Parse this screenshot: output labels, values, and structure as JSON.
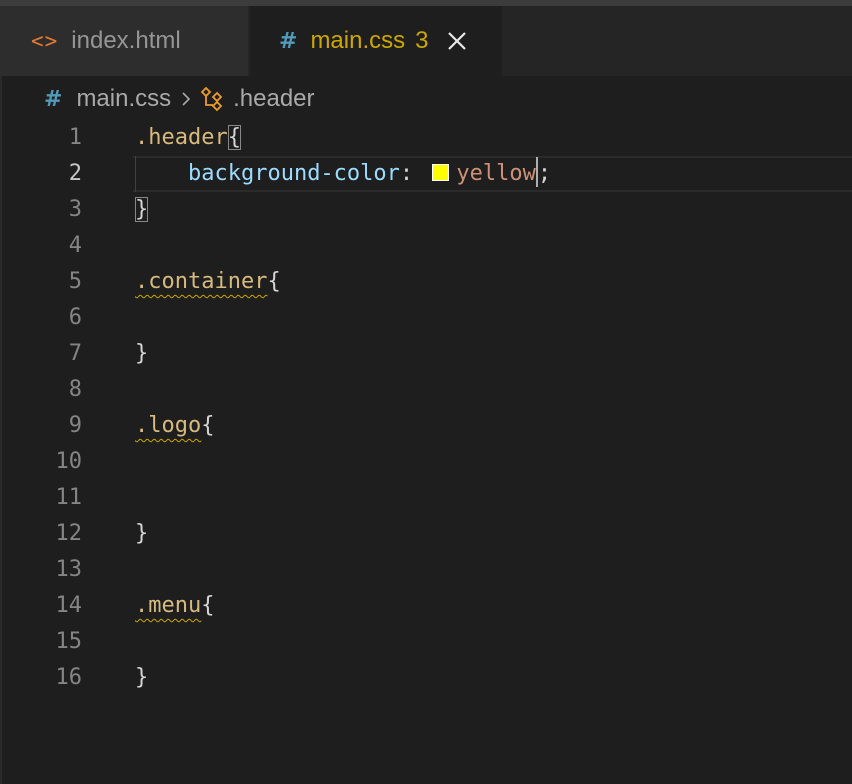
{
  "tabs": [
    {
      "icon": "html-file-icon",
      "glyph": "<>",
      "label": "index.html"
    },
    {
      "icon": "css-file-icon",
      "glyph": "#",
      "label": "main.css",
      "problems": "3",
      "active": true
    }
  ],
  "breadcrumb": {
    "file_glyph": "#",
    "file": "main.css",
    "symbol": ".header"
  },
  "colors": {
    "selector": "#d7ba7d",
    "property": "#9cdcfe",
    "value": "#ce9178",
    "warning": "#cca700",
    "swatch": "#ffff00"
  },
  "editor": {
    "current_line": 2,
    "line_numbers": [
      "1",
      "2",
      "3",
      "4",
      "5",
      "6",
      "7",
      "8",
      "9",
      "10",
      "11",
      "12",
      "13",
      "14",
      "15",
      "16"
    ],
    "code": {
      "l1_selector": ".header",
      "l1_brace": "{",
      "l2_indent": "    ",
      "l2_property": "background-color",
      "l2_colon": ":",
      "l2_value": "yellow",
      "l2_semicolon": ";",
      "l3_brace": "}",
      "l5_selector": ".container",
      "l5_brace": "{",
      "l7_brace": "}",
      "l9_selector": ".logo",
      "l9_brace": "{",
      "l12_brace": "}",
      "l14_selector": ".menu",
      "l14_brace": "{",
      "l16_brace": "}"
    }
  }
}
